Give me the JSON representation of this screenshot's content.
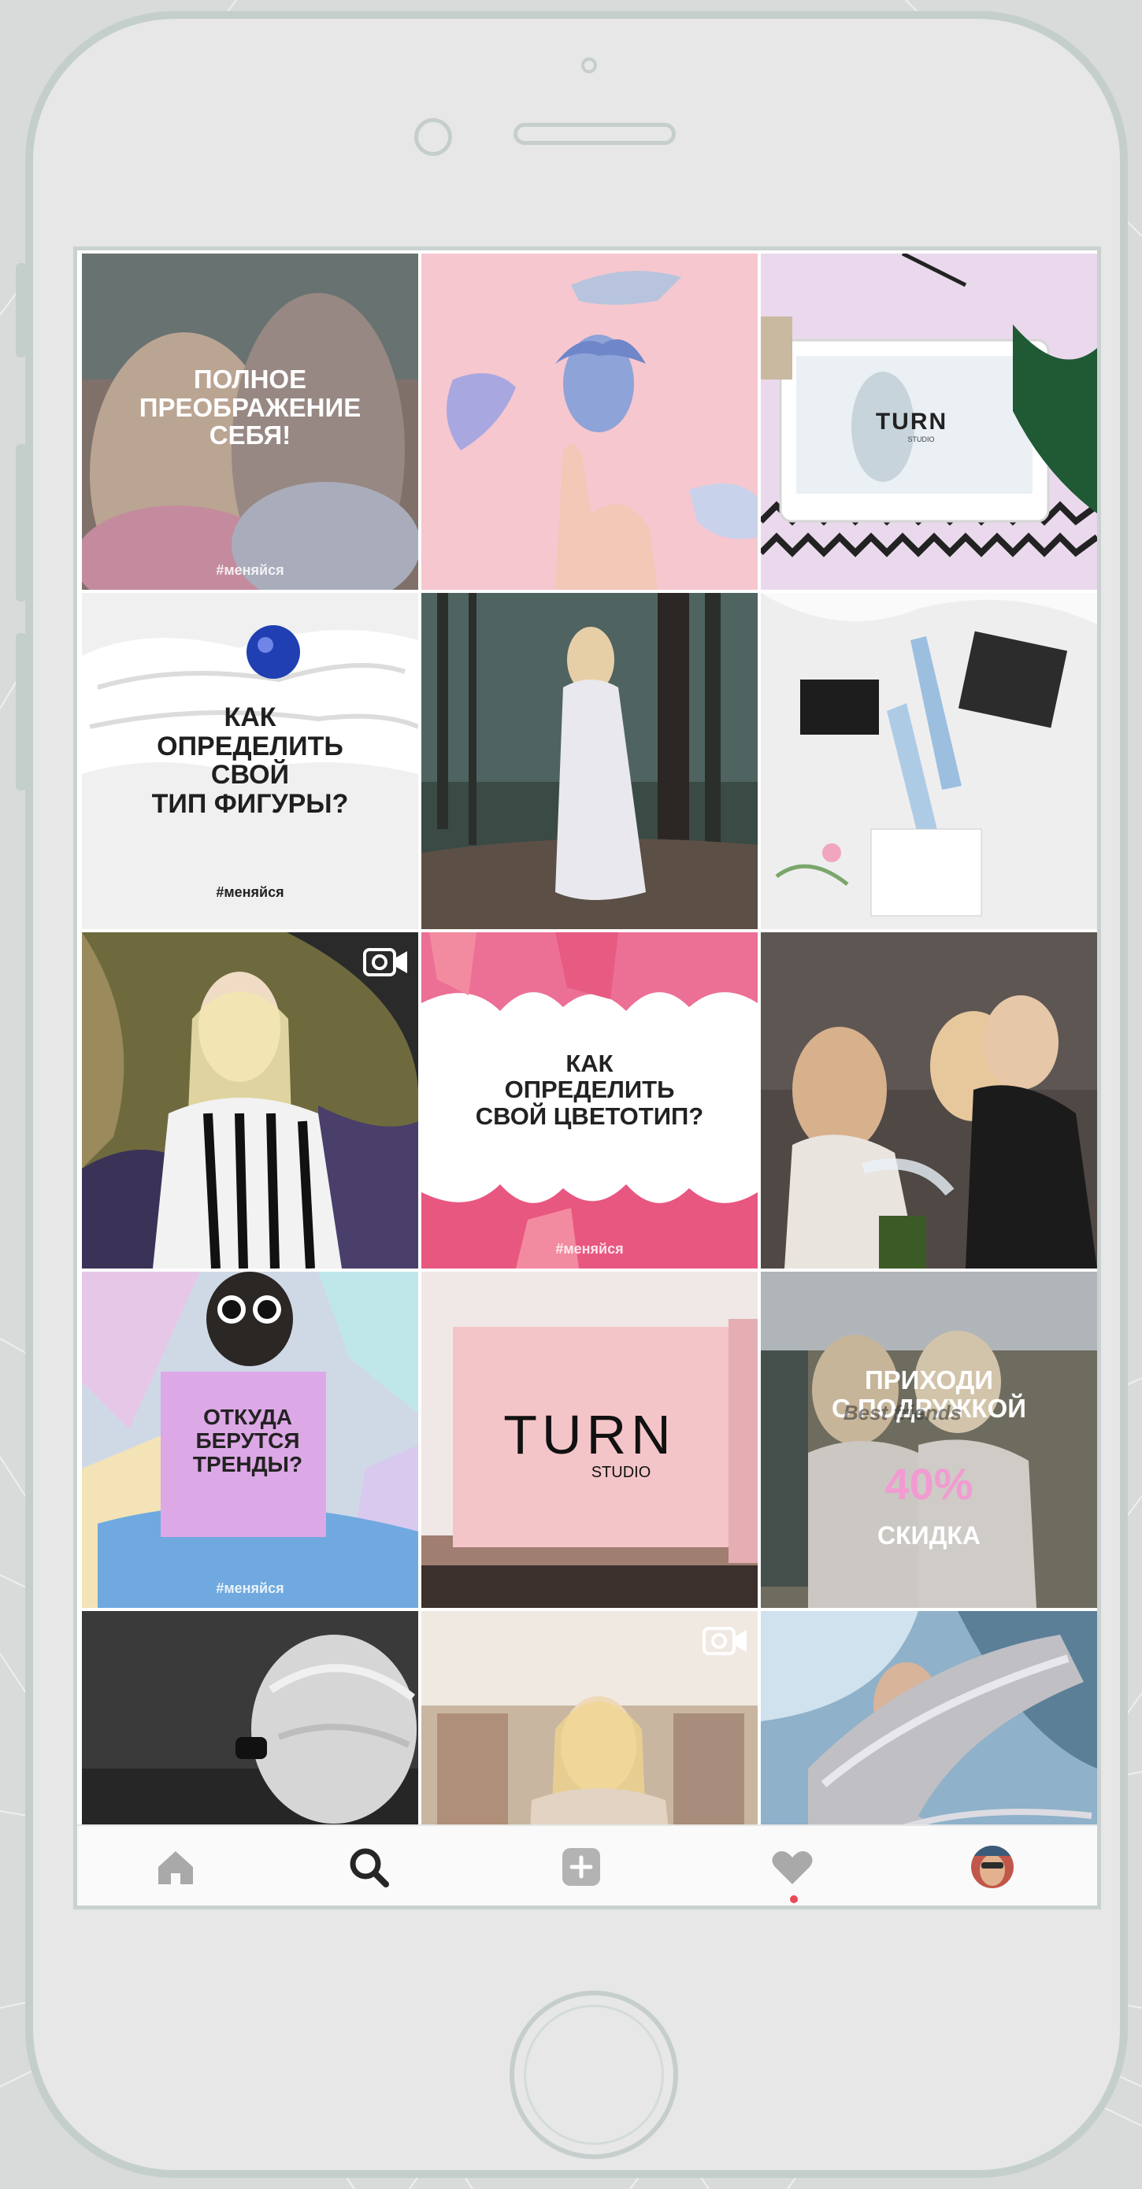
{
  "posts": [
    {
      "caption": "ПОЛНОЕ\nПРЕОБРАЖЕНИЕ\nСЕБЯ!",
      "hashtag": "#меняйся"
    },
    {
      "caption": "",
      "hashtag": ""
    },
    {
      "caption": "",
      "hashtag": "",
      "logo": "TURN",
      "logo_sub": "STUDIO"
    },
    {
      "caption": "КАК\nОПРЕДЕЛИТЬ\nСВОЙ\nТИП ФИГУРЫ?",
      "hashtag": "#меняйся"
    },
    {
      "caption": "",
      "hashtag": ""
    },
    {
      "caption": "",
      "hashtag": ""
    },
    {
      "caption": "",
      "hashtag": "",
      "video": true
    },
    {
      "caption": "КАК\nОПРЕДЕЛИТЬ\nСВОЙ ЦВЕТОТИП?",
      "hashtag": "#меняйся"
    },
    {
      "caption": "",
      "hashtag": ""
    },
    {
      "caption": "ОТКУДА\nБЕРУТСЯ\nТРЕНДЫ?",
      "hashtag": "#меняйся"
    },
    {
      "caption": "",
      "hashtag": "",
      "logo": "TURN",
      "logo_sub": "STUDIO"
    },
    {
      "caption": "ПРИХОДИ\nС ПОДРУЖКОЙ",
      "discount": "40%",
      "discount_label": "СКИДКА",
      "shirt_text": "Best friends"
    },
    {
      "caption": "",
      "hashtag": ""
    },
    {
      "caption": "",
      "hashtag": "",
      "video": true
    },
    {
      "caption": "",
      "hashtag": ""
    }
  ],
  "nav": {
    "items": [
      "home-icon",
      "search-icon",
      "add-post-icon",
      "heart-icon",
      "profile-avatar"
    ],
    "active": "search-icon",
    "notification_color": "#ed4956"
  },
  "colors": {
    "frame": "#c4cfcc",
    "pink": "#f5c6cd",
    "lilac": "#d8a6e4",
    "discount": "#f29bd2"
  }
}
